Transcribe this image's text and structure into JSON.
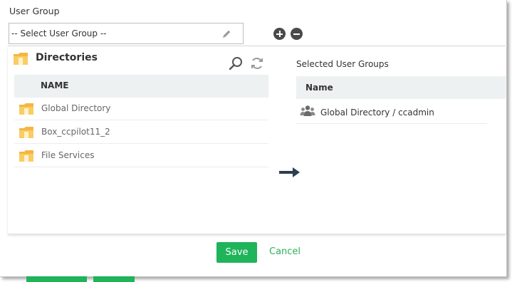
{
  "user_group": {
    "label": "User Group",
    "select_value": "-- Select User Group --"
  },
  "directories": {
    "title": "Directories",
    "column_header": "NAME",
    "items": [
      {
        "label": "Global Directory"
      },
      {
        "label": "Box_ccpilot11_2"
      },
      {
        "label": "File Services"
      }
    ]
  },
  "selected": {
    "title": "Selected User Groups",
    "column_header": "Name",
    "items": [
      {
        "label": "Global Directory / ccadmin"
      }
    ]
  },
  "footer": {
    "save_label": "Save",
    "cancel_label": "Cancel"
  },
  "colors": {
    "accent_green": "#1fb35a",
    "folder_yellow": "#f7c04a",
    "header_bg": "#edf1f2",
    "arrow_navy": "#2c3e50"
  },
  "icons": {
    "edit": "pencil-icon",
    "add": "plus-circle-icon",
    "remove": "minus-circle-icon",
    "folder": "folder-icon",
    "search": "search-icon",
    "refresh": "refresh-icon",
    "group": "user-group-icon",
    "move": "arrow-right-icon"
  }
}
